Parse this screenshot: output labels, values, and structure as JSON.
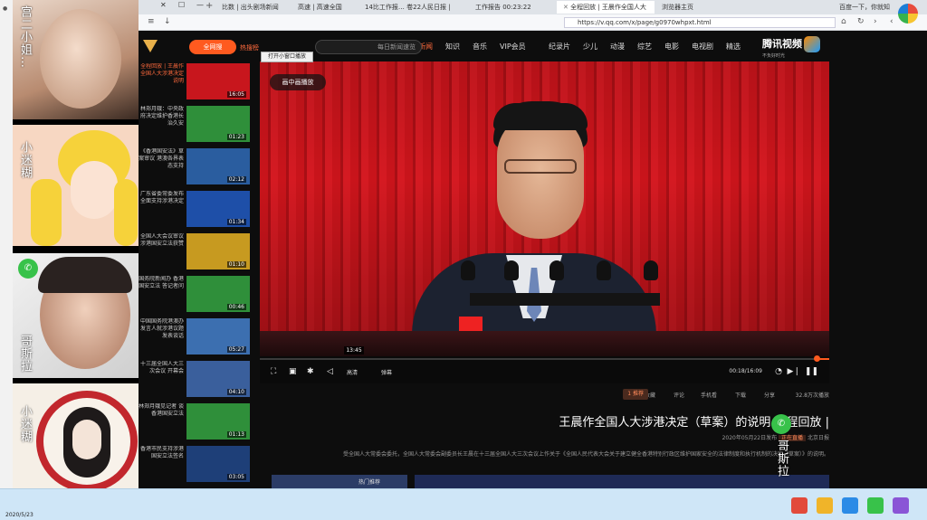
{
  "browser": {
    "tabs": [
      {
        "label": "浏览器主页",
        "active": false
      },
      {
        "label": "全程回放 | 王晨作全国人大",
        "active": true
      },
      {
        "label": "工作报告 00:23:22",
        "active": false
      },
      {
        "label": "14比工作报… 卷22人民日报 |",
        "active": false
      },
      {
        "label": "高速 | 高速全国",
        "active": false
      },
      {
        "label": "比数 | 出头剧场新闻",
        "active": false
      }
    ],
    "address": "https://v.qq.com/x/page/g0970whpxt.html",
    "new_tab": "+",
    "window_controls": [
      "—",
      "☐",
      "✕"
    ],
    "left_tab_label": "百度一下，你就知道"
  },
  "site": {
    "logo_text": "腾讯视频",
    "logo_sub": "不负好时光",
    "nav": [
      "精选",
      "电视剧",
      "电影",
      "综艺",
      "动漫",
      "少儿",
      "纪录片",
      "VIP会员",
      "音乐",
      "知识",
      "新闻"
    ],
    "hot_nav": "新闻",
    "search_placeholder": "每日新闻速览",
    "hot_link": "热搜榜",
    "full_button": "全网搜"
  },
  "video": {
    "tooltip": "打开小窗口播放",
    "pip_label": "画中画播放",
    "hover_time": "13:45",
    "current_time": "00:18/16:09",
    "controls": {
      "quality": "高清",
      "danmaku": "弹幕"
    },
    "progress_pct": 2
  },
  "actions": {
    "items": [
      "32.8万次播放",
      "分享",
      "下载",
      "手机看",
      "评论",
      "收藏"
    ],
    "badge": "1 推荐"
  },
  "title": {
    "lead": "全程回放 |",
    "text": "王晨作全国人大涉港决定（草案）的说明"
  },
  "meta": {
    "source": "北京日报",
    "tag": "正在直播",
    "date": "2020年05月22日发布"
  },
  "description": "受全国人大常委会委托，全国人大常委会副委员长王晨在十三届全国人大三次会议上作关于《全国人民代表大会关于建立健全香港特别行政区维护国家安全的法律制度和执行机制的决定（草案）》的说明。",
  "strip": {
    "label": "热门推荐"
  },
  "sidelist": [
    {
      "title": "全程回放 | 王晨作全国人大涉港决定说明",
      "dur": "16:05",
      "color": "#c8161d"
    },
    {
      "title": "林郑月娥：中央政府决定维护香港长治久安",
      "dur": "01:23",
      "color": "#2f8f3a"
    },
    {
      "title": "《香港国安法》草案审议 港澳各界表态支持",
      "dur": "02:12",
      "color": "#2a5d9f"
    },
    {
      "title": "广东省委常委发布 全面支持涉港决定",
      "dur": "01:34",
      "color": "#1e4fa8"
    },
    {
      "title": "全国人大会议审议 涉港国安立法获赞",
      "dur": "01:10",
      "color": "#c79a20"
    },
    {
      "title": "国务院新闻办 香港国安立法 答记者问",
      "dur": "00:46",
      "color": "#2f8f3a"
    },
    {
      "title": "中国国务院港澳办 发言人就涉港议题发表谈话",
      "dur": "05:27",
      "color": "#3c6fb0"
    },
    {
      "title": "十三届全国人大三次会议 开幕会",
      "dur": "04:10",
      "color": "#3a5f9c"
    },
    {
      "title": "林郑月娥见记者 谈香港国安立法",
      "dur": "01:13",
      "color": "#2f8f3a"
    },
    {
      "title": "香港市民支持涉港国安立法签名",
      "dur": "03:05",
      "color": "#1e3f78"
    }
  ],
  "floating": [
    {
      "label": "宫二小姐…"
    },
    {
      "label": "小迷糊"
    },
    {
      "label": "哥斯拉"
    },
    {
      "label": "小迷糊"
    }
  ],
  "overlay_user": {
    "label": "哥斯拉"
  },
  "taskbar": {
    "date": "2020/5/23",
    "icons": [
      "#e24a3b",
      "#f0b429",
      "#2b8be6",
      "#38c24a",
      "#8a55d6"
    ]
  }
}
